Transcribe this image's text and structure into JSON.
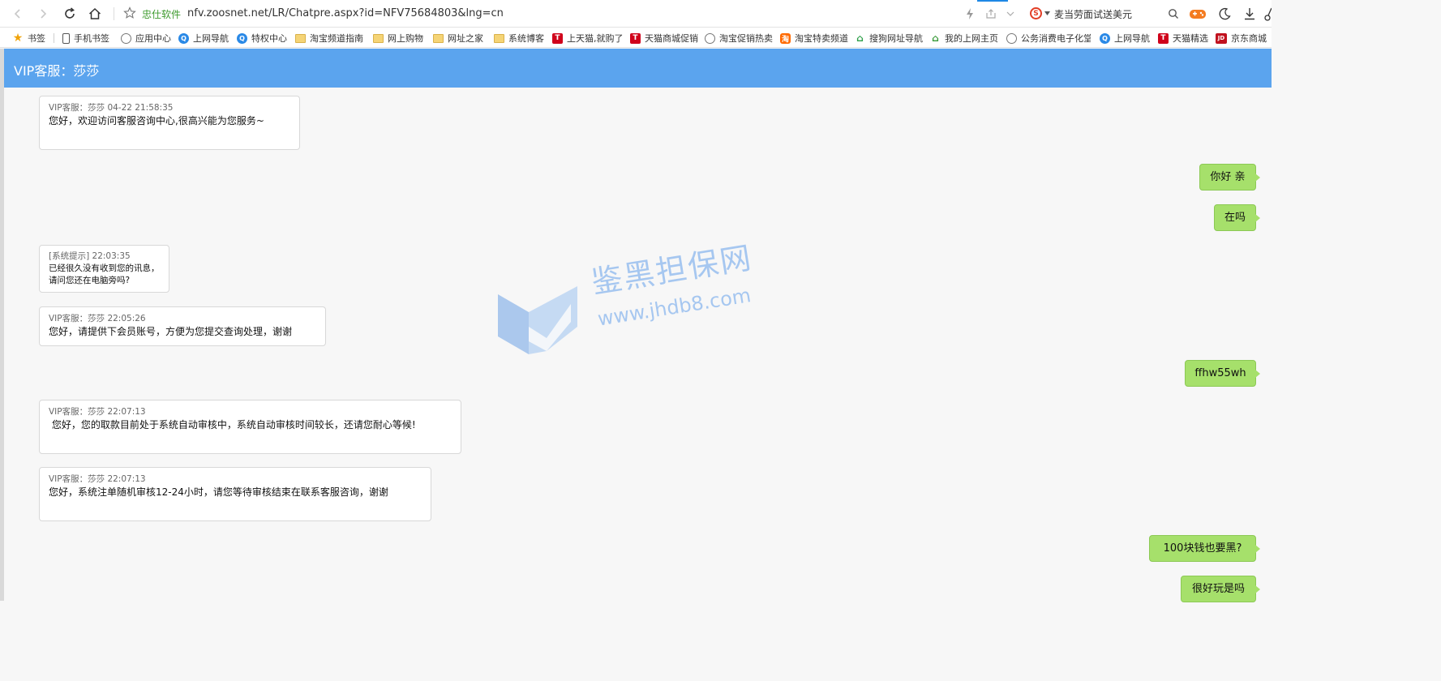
{
  "browser": {
    "site_label": "忠仕软件",
    "url": "nfv.zoosnet.net/LR/Chatpre.aspx?id=NFV75684803&lng=cn",
    "search_text": "麦当劳面试送美元",
    "search_engine_glyph": "S"
  },
  "bookmarks": [
    {
      "label": "书签",
      "icon": "star-icon"
    },
    {
      "label": "手机书签",
      "icon": "phone-icon"
    },
    {
      "label": "应用中心",
      "icon": "globe-icon"
    },
    {
      "label": "上网导航",
      "icon": "qq-browser-icon"
    },
    {
      "label": "特权中心",
      "icon": "qq-browser-icon"
    },
    {
      "label": "淘宝频道指南",
      "icon": "folder-icon"
    },
    {
      "label": "网上购物",
      "icon": "folder-icon"
    },
    {
      "label": "网址之家",
      "icon": "folder-icon"
    },
    {
      "label": "系统博客",
      "icon": "folder-icon"
    },
    {
      "label": "上天猫,就购了",
      "icon": "tmall-icon"
    },
    {
      "label": "天猫商城促销",
      "icon": "tmall-icon"
    },
    {
      "label": "淘宝促销热卖",
      "icon": "globe-icon"
    },
    {
      "label": "淘宝特卖频道",
      "icon": "taobao-icon"
    },
    {
      "label": "搜狗网址导航",
      "icon": "sogou-icon"
    },
    {
      "label": "我的上网主页",
      "icon": "home-icon"
    },
    {
      "label": "公务消费电子化堂",
      "icon": "globe-icon"
    },
    {
      "label": "上网导航",
      "icon": "qq-browser-icon"
    },
    {
      "label": "天猫精选",
      "icon": "tmall-icon"
    },
    {
      "label": "京东商城",
      "icon": "jd-icon"
    }
  ],
  "icon_glyphs": {
    "tmall": "T",
    "taobao": "淘",
    "qq": "Q",
    "jd": "JD",
    "star": "★"
  },
  "chat": {
    "title": "VIP客服：莎莎",
    "messages": [
      {
        "meta": "VIP客服：莎莎  04-22 21:58:35",
        "text": "您好，欢迎访问客服咨询中心,很高兴能为您服务~"
      },
      {
        "mine": "你好 亲"
      },
      {
        "mine": "在吗"
      },
      {
        "meta": "[系统提示] 22:03:35",
        "line1": "已经很久没有收到您的讯息，",
        "line2": "请问您还在电脑旁吗?"
      },
      {
        "meta": "VIP客服：莎莎 22:05:26",
        "text": "您好，请提供下会员账号，方便为您提交查询处理，谢谢"
      },
      {
        "mine": "ffhw55wh"
      },
      {
        "meta": "VIP客服：莎莎 22:07:13",
        "text": " 您好，您的取款目前处于系统自动审核中，系统自动审核时间较长，还请您耐心等候!"
      },
      {
        "meta": "VIP客服：莎莎 22:07:13",
        "text": "您好，系统注单随机审核12-24小时，请您等待审核结束在联系客服咨询，谢谢"
      },
      {
        "mine": "100块钱也要黑?"
      },
      {
        "mine": "很好玩是吗"
      }
    ]
  },
  "watermark": {
    "cn": "鉴黑担保网",
    "en": "www.jhdb8.com"
  },
  "colors": {
    "header": "#5ba4ee",
    "my_bubble": "#a6e06b",
    "page_bg": "#f7f7f7"
  }
}
